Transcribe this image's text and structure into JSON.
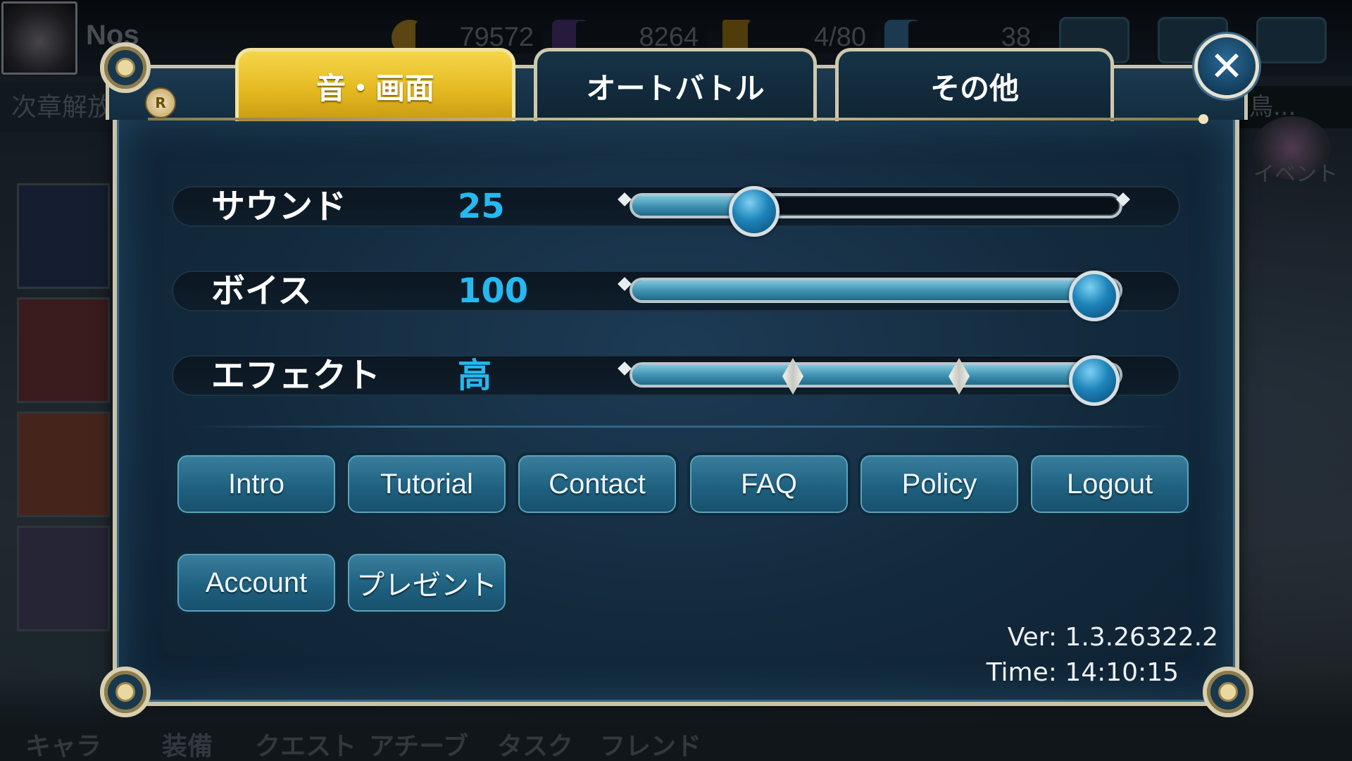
{
  "background": {
    "player_name": "Nos",
    "resources": [
      {
        "icon": "gold-coin-icon",
        "value": "79572"
      },
      {
        "icon": "crystal-icon",
        "value": "8264"
      },
      {
        "icon": "lightning-icon",
        "value": "4/80"
      },
      {
        "icon": "diamond-icon",
        "value": "38"
      }
    ],
    "chapter_label": "次章解放",
    "right_label": "鳥...",
    "event_label": "イベント",
    "bottom_nav": [
      "キャラ",
      "装備",
      "クエスト",
      "アチーブ",
      "タスク",
      "フレンド"
    ]
  },
  "tabs": [
    {
      "label": "音・画面",
      "active": true
    },
    {
      "label": "オートバトル",
      "active": false
    },
    {
      "label": "その他",
      "active": false
    }
  ],
  "settings": {
    "sound": {
      "label": "サウンド",
      "value": "25",
      "level": 0.25
    },
    "voice": {
      "label": "ボイス",
      "value": "100",
      "level": 1.0
    },
    "effect": {
      "label": "エフェクト",
      "value": "高",
      "level": 1.0,
      "notches": [
        0.33,
        0.67
      ]
    }
  },
  "buttons": {
    "intro": "Intro",
    "tutorial": "Tutorial",
    "contact": "Contact",
    "faq": "FAQ",
    "policy": "Policy",
    "logout": "Logout",
    "account": "Account",
    "present": "プレゼント"
  },
  "footer": {
    "version": "Ver: 1.3.26322.2",
    "time": "Time: 14:10:15"
  },
  "colors": {
    "active_tab": "#e3b71e",
    "value_text": "#26b8ef",
    "button": "#1f6180"
  }
}
